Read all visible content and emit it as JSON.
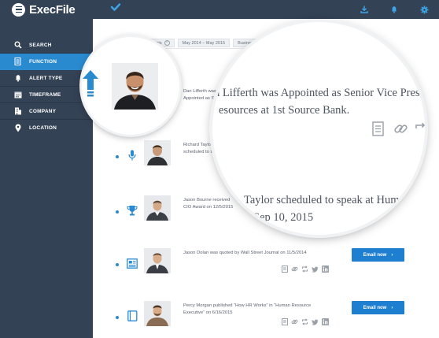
{
  "app": {
    "name": "ExecFile"
  },
  "header": {
    "icons": [
      "check-icon",
      "download-icon",
      "bell-icon",
      "gear-icon"
    ]
  },
  "sidebar": {
    "items": [
      {
        "label": "SEARCH",
        "icon": "search-icon",
        "active": false
      },
      {
        "label": "FUNCTION",
        "icon": "document-icon",
        "active": true
      },
      {
        "label": "ALERT TYPE",
        "icon": "bell-icon",
        "active": false
      },
      {
        "label": "TIMEFRAME",
        "icon": "calendar-icon",
        "active": false
      },
      {
        "label": "COMPANY",
        "icon": "building-icon",
        "active": false
      },
      {
        "label": "LOCATION",
        "icon": "pin-icon",
        "active": false
      }
    ]
  },
  "filters": [
    "Appointments",
    "May 2014 – May 2015",
    "Business Servic"
  ],
  "feed": [
    {
      "text": "Dan Lifferth was Appointed as Senior Vice President, Human Resources at 1st Source Bank.",
      "icon": "arrow-up-icon"
    },
    {
      "text": "Richard Taylor scheduled to speak at Human Resource Forum on Sep 10, 2015",
      "icon": "microphone-icon"
    },
    {
      "text": "Jason Bourne received CIO Award on 12/5/2015",
      "icon": "trophy-icon"
    },
    {
      "text": "Jason Dolan was quoted by Wall Street Journal on 11/5/2014",
      "icon": "newspaper-icon",
      "button": "Email now"
    },
    {
      "text": "Percy Morgan published “How HR Works” in “Human Resource Executive” on 6/16/2015",
      "icon": "book-icon",
      "button": "Email now"
    }
  ],
  "zoom": {
    "line1": "n Lifferth was Appointed as Senior Vice Preside",
    "line2": "esources at 1st Source Bank.",
    "line3": "Taylor scheduled to speak at Human",
    "line4": "Sep 10, 2015"
  },
  "colors": {
    "sidebar": "#344255",
    "accent": "#2a8ad0",
    "button": "#1e7fd1"
  }
}
